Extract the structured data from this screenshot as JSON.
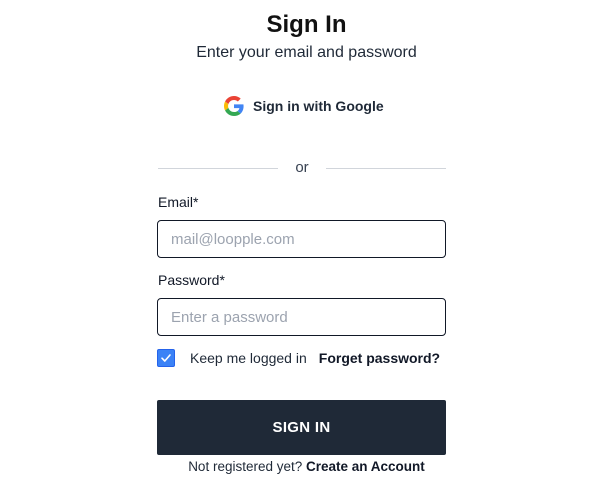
{
  "header": {
    "title": "Sign In",
    "subtitle": "Enter your email and password"
  },
  "google": {
    "label": "Sign in with Google",
    "icon": "google-g-icon"
  },
  "divider": {
    "text": "or"
  },
  "form": {
    "email": {
      "label": "Email*",
      "placeholder": "mail@loopple.com",
      "value": ""
    },
    "password": {
      "label": "Password*",
      "placeholder": "Enter a password",
      "value": ""
    },
    "remember": {
      "label": "Keep me logged in",
      "checked": true,
      "checkbox_color": "#3b82f6"
    },
    "forgot_label": "Forget password?",
    "submit_label": "SIGN IN",
    "submit_color": "#1f2937"
  },
  "footer": {
    "prompt": "Not registered yet?",
    "link_label": "Create an Account"
  }
}
